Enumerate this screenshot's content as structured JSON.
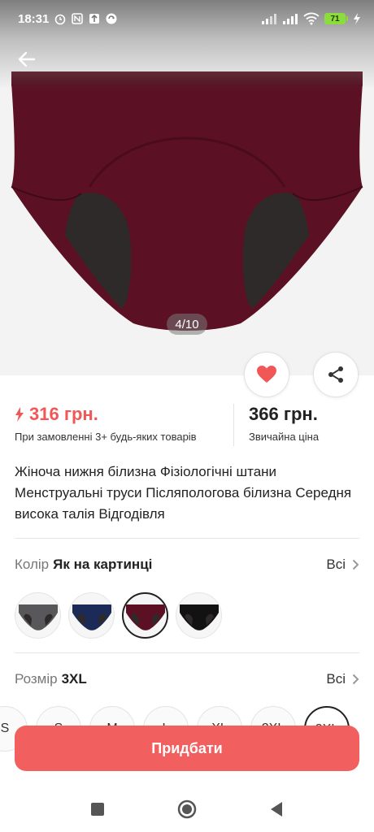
{
  "status_bar": {
    "time": "18:31",
    "battery": "71",
    "icons": [
      "alarm-icon",
      "nfc-icon",
      "upload-icon",
      "sync-icon",
      "signal-icon",
      "signal-icon",
      "wifi-icon",
      "battery-icon",
      "charging-icon"
    ]
  },
  "gallery": {
    "counter": "4/10"
  },
  "price": {
    "promo": "316 грн.",
    "promo_note": "При замовленні 3+ будь-яких товарів",
    "regular": "366 грн.",
    "regular_note": "Звичайна ціна"
  },
  "product": {
    "title": "Жіноча нижня білизна Фізіологічні штани Менструальні труси Післяпологова білизна Середня висока талія Відгодівля"
  },
  "color_option": {
    "label": "Колір",
    "value": "Як на картинці",
    "all": "Всі",
    "swatches": [
      {
        "color": "#58585a",
        "selected": false
      },
      {
        "color": "#1b2a57",
        "selected": false
      },
      {
        "color": "#5c1024",
        "selected": true
      },
      {
        "color": "#121212",
        "selected": false
      }
    ]
  },
  "size_option": {
    "label": "Розмір",
    "value": "3XL",
    "all": "Всі",
    "sizes": [
      "S",
      "S",
      "M",
      "L",
      "XL",
      "2XL",
      "3XL"
    ]
  },
  "actions": {
    "buy": "Придбати"
  },
  "colors": {
    "accent": "#f25f5f",
    "product": "#5c1024"
  }
}
